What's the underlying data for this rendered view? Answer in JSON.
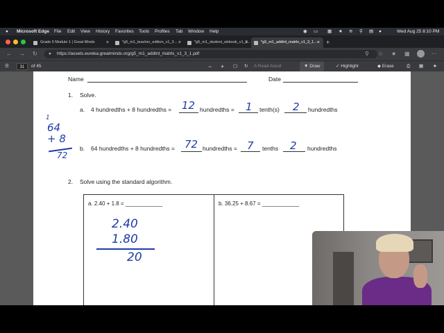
{
  "menubar": {
    "apple": "",
    "app": "Microsoft Edge",
    "menus": [
      "File",
      "Edit",
      "View",
      "History",
      "Favorites",
      "Tools",
      "Profiles",
      "Tab",
      "Window",
      "Help"
    ],
    "datetime": "Wed Aug 25  8:10 PM"
  },
  "tabs": [
    {
      "label": "Grade 5 Module 1 | Great Minds",
      "active": false
    },
    {
      "label": "*g5_m1_teacher_edition_v1_3...",
      "active": false
    },
    {
      "label": "*g5_m1_student_wkbook_v1_3...",
      "active": false
    },
    {
      "label": "*g5_m1_addtnl_matrls_v1_3_1...",
      "active": true
    }
  ],
  "address": {
    "url": "https://assets.eureka.greatminds.org/g5_m1_addtnl_matrls_v1_3_1.pdf"
  },
  "pdf_toolbar": {
    "page": "31",
    "page_total": "of 45",
    "minus": "−",
    "plus": "+",
    "read_aloud": "Read Aloud",
    "draw": "Draw",
    "highlight": "Highlight",
    "erase": "Erase"
  },
  "worksheet": {
    "name_label": "Name",
    "date_label": "Date",
    "q1_number": "1.",
    "q1_title": "Solve.",
    "q1a_letter": "a.",
    "q1a_lhs": "4 hundredths + 8 hundredths =",
    "q1a_mid1": "hundredths =",
    "q1a_mid2": "tenth(s)",
    "q1a_end": "hundredths",
    "q1a_ans1": "12",
    "q1a_ans2": "1",
    "q1a_ans3": "2",
    "q1b_letter": "b.",
    "q1b_lhs": "64 hundredths + 8 hundredths =",
    "q1b_mid1": "hundredths =",
    "q1b_mid2": "tenths",
    "q1b_end": "hundredths",
    "q1b_ans1": "72",
    "q1b_ans2": "7",
    "q1b_ans3": "2",
    "side_work": {
      "carry": "1",
      "top": "64",
      "add": "+ 8",
      "sum": "72"
    },
    "q2_number": "2.",
    "q2_title": "Solve using the standard algorithm.",
    "q2a": "a.  2.40 + 1.8 = ____________",
    "q2b": "b.  36.25 + 8.67 = ____________",
    "q2a_work": {
      "line1": "2.40",
      "line2": "1.80",
      "result": "20"
    }
  },
  "colors": {
    "ink": "#1d3aa8",
    "menubar": "#2a2c33",
    "tab_active": "#3a3b3f"
  }
}
